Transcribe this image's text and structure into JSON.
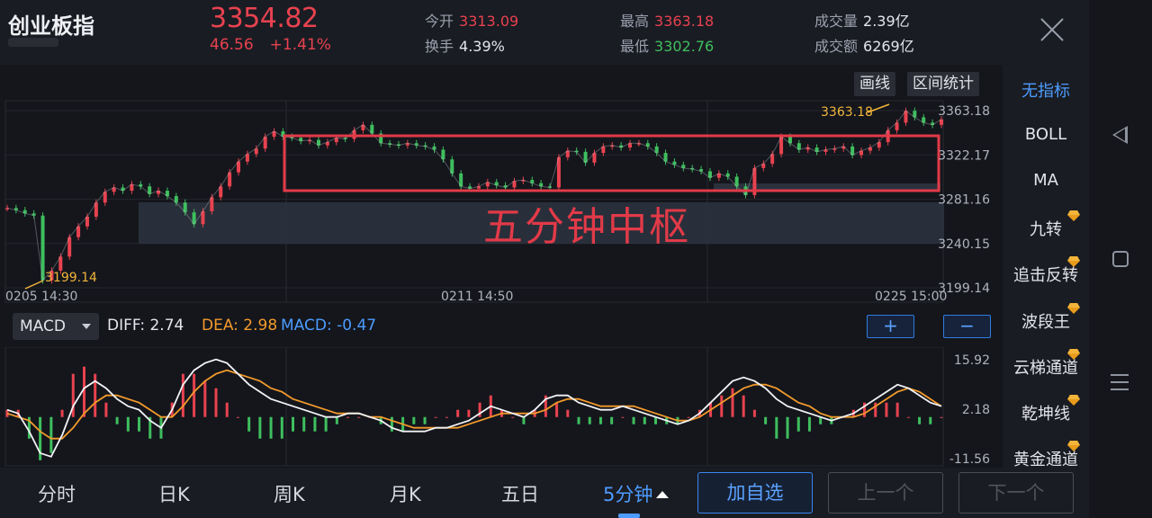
{
  "header": {
    "title": "创业板指",
    "price": "3354.82",
    "change": "46.56",
    "change_pct": "+1.41%",
    "stats": {
      "open_label": "今开",
      "open": "3313.09",
      "turnover_rate_label": "换手",
      "turnover_rate": "4.39%",
      "high_label": "最高",
      "high": "3363.18",
      "low_label": "最低",
      "low": "3302.76",
      "volume_label": "成交量",
      "volume": "2.39亿",
      "amount_label": "成交额",
      "amount": "6269亿"
    }
  },
  "toolbar": {
    "draw_label": "画线",
    "range_stat_label": "区间统计"
  },
  "annotation": {
    "label": "五分钟中枢"
  },
  "price_axis": [
    "3363.18",
    "3322.17",
    "3281.16",
    "3240.15",
    "3199.14"
  ],
  "price_marks": {
    "max_label": "3363.18",
    "min_label": "3199.14"
  },
  "time_axis": [
    "0205  14:30",
    "0211  14:50",
    "0225  15:00"
  ],
  "macd": {
    "selector": "MACD",
    "diff_label": "DIFF: 2.74",
    "dea_label": "DEA: 2.98",
    "macd_label": "MACD: -0.47",
    "axis": [
      "15.92",
      "2.18",
      "-11.56"
    ],
    "zoom_in": "+",
    "zoom_out": "−"
  },
  "indicators": {
    "items": [
      {
        "label": "无指标",
        "premium": false
      },
      {
        "label": "BOLL",
        "premium": false
      },
      {
        "label": "MA",
        "premium": false
      },
      {
        "label": "九转",
        "premium": true
      },
      {
        "label": "追击反转",
        "premium": true
      },
      {
        "label": "波段王",
        "premium": true
      },
      {
        "label": "云梯通道",
        "premium": true
      },
      {
        "label": "乾坤线",
        "premium": true
      },
      {
        "label": "黄金通道",
        "premium": true
      }
    ]
  },
  "tabs": [
    "分时",
    "日K",
    "周K",
    "月K",
    "五日",
    "5分钟"
  ],
  "actions": {
    "add_watchlist": "加自选",
    "prev": "上一个",
    "next": "下一个"
  },
  "colors": {
    "up": "#e8424f",
    "down": "#3fbf5e",
    "accent": "#4d9cff",
    "dea": "#f39a2b",
    "box": "#e23a48"
  },
  "chart_data": {
    "type": "line",
    "price_ylim": [
      3199.14,
      3363.18
    ],
    "price_y_ticks": [
      3363.18,
      3322.17,
      3281.16,
      3240.15,
      3199.14
    ],
    "x_ticks": [
      "0205  14:30",
      "0211  14:50",
      "0225  15:00"
    ],
    "close": [
      3273,
      3271,
      3268,
      3266,
      3206,
      3215,
      3228,
      3246,
      3256,
      3265,
      3278,
      3288,
      3292,
      3289,
      3295,
      3293,
      3286,
      3289,
      3284,
      3278,
      3269,
      3258,
      3270,
      3283,
      3293,
      3306,
      3316,
      3323,
      3328,
      3339,
      3344,
      3339,
      3338,
      3335,
      3336,
      3331,
      3334,
      3338,
      3337,
      3345,
      3350,
      3342,
      3333,
      3332,
      3331,
      3333,
      3331,
      3330,
      3327,
      3318,
      3305,
      3293,
      3291,
      3293,
      3297,
      3294,
      3292,
      3298,
      3299,
      3296,
      3293,
      3292,
      3320,
      3326,
      3325,
      3315,
      3324,
      3330,
      3331,
      3329,
      3333,
      3333,
      3330,
      3324,
      3316,
      3313,
      3310,
      3309,
      3307,
      3301,
      3305,
      3302,
      3293,
      3285,
      3310,
      3314,
      3323,
      3339,
      3333,
      3327,
      3329,
      3325,
      3327,
      3328,
      3330,
      3322,
      3326,
      3329,
      3334,
      3345,
      3352,
      3363,
      3357,
      3352,
      3350,
      3355
    ],
    "macd_ylim": [
      -11.56,
      15.92
    ],
    "macd_y_ticks": [
      15.92,
      2.18,
      -11.56
    ],
    "diff": [
      2,
      1,
      -4,
      -10,
      -11,
      -5,
      3,
      8,
      10,
      8,
      5,
      3,
      2,
      -1,
      -3,
      2,
      9,
      13,
      15,
      16,
      15,
      12,
      9,
      7,
      5,
      4,
      3,
      2,
      1,
      0,
      0,
      1,
      1,
      0,
      -1,
      -3,
      -4,
      -4,
      -4,
      -3,
      -3,
      -2,
      -1,
      1,
      3,
      2,
      1,
      0,
      2,
      5,
      6,
      6,
      4,
      3,
      2,
      2,
      3,
      2,
      1,
      0,
      -1,
      -2,
      -1,
      1,
      4,
      7,
      10,
      11,
      10,
      8,
      5,
      3,
      2,
      1,
      0,
      -1,
      0,
      1,
      3,
      5,
      7,
      9,
      8,
      6,
      4,
      3
    ],
    "dea": [
      1,
      0,
      -1,
      -4,
      -6,
      -6,
      -3,
      1,
      4,
      6,
      6,
      5,
      4,
      2,
      0,
      0,
      3,
      7,
      10,
      12,
      13,
      12,
      11,
      10,
      8,
      7,
      5,
      4,
      3,
      2,
      1,
      1,
      1,
      0,
      0,
      -1,
      -2,
      -3,
      -3,
      -3,
      -3,
      -3,
      -2,
      -1,
      0,
      1,
      1,
      1,
      1,
      2,
      4,
      5,
      5,
      4,
      3,
      3,
      3,
      3,
      2,
      1,
      0,
      -1,
      -1,
      0,
      2,
      4,
      6,
      8,
      9,
      9,
      8,
      6,
      4,
      3,
      1,
      0,
      0,
      0,
      1,
      3,
      5,
      7,
      8,
      7,
      5,
      3
    ]
  }
}
